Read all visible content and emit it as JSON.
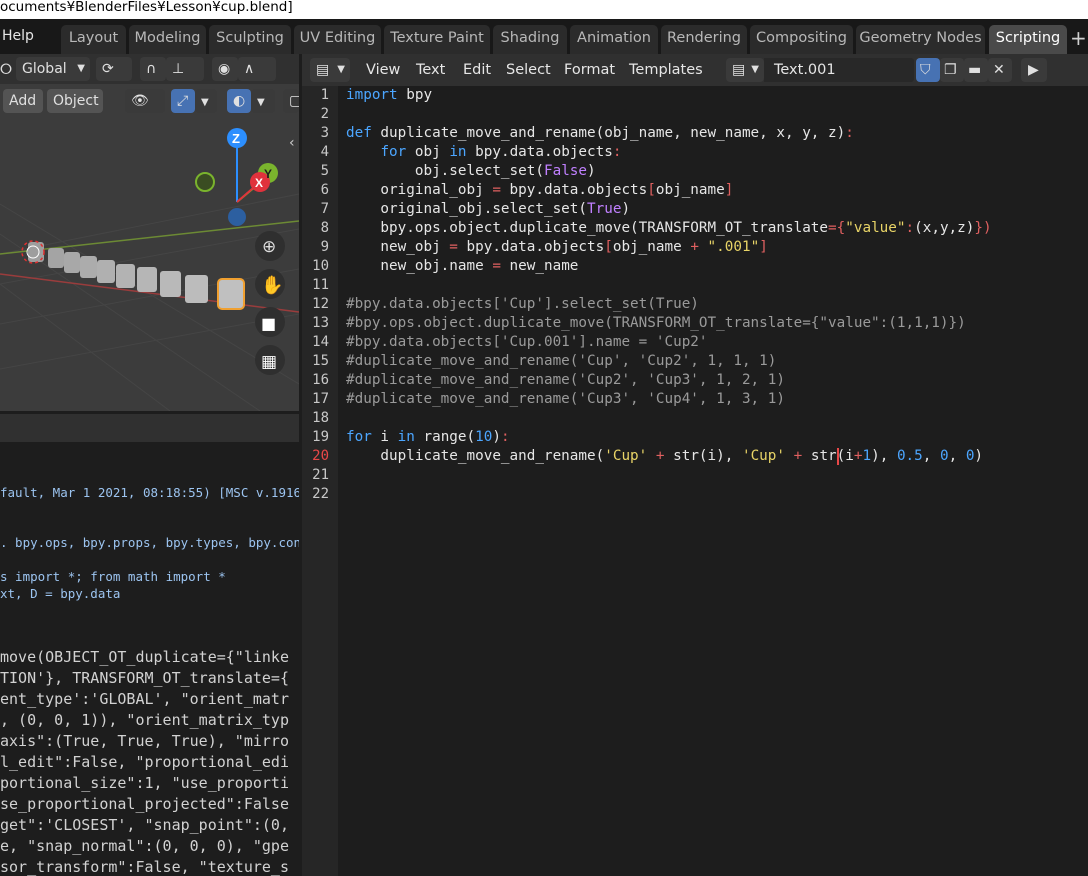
{
  "window": {
    "title": "ocuments¥BlenderFiles¥Lesson¥cup.blend]"
  },
  "topbar": {
    "help_label": "Help",
    "tabs": [
      {
        "label": "Layout"
      },
      {
        "label": "Modeling"
      },
      {
        "label": "Sculpting"
      },
      {
        "label": "UV Editing"
      },
      {
        "label": "Texture Paint"
      },
      {
        "label": "Shading"
      },
      {
        "label": "Animation"
      },
      {
        "label": "Rendering"
      },
      {
        "label": "Compositing"
      },
      {
        "label": "Geometry Nodes"
      },
      {
        "label": "Scripting",
        "active": true
      }
    ],
    "add_tab_symbol": "+"
  },
  "viewport": {
    "orientation_label": "Global",
    "add_label": "Add",
    "object_label": "Object",
    "gizmo_z": "Z",
    "gizmo_y": "Y",
    "gizmo_x": "X"
  },
  "console": {
    "lines": [
      "fault, Mar  1 2021, 08:18:55) [MSC v.1916",
      ". bpy.ops, bpy.props, bpy.types, bpy.cont",
      "s import *; from math import *",
      "xt, D = bpy.data"
    ]
  },
  "info": {
    "lines": [
      "move(OBJECT_OT_duplicate={\"linke",
      "TION'}, TRANSFORM_OT_translate={",
      "ent_type':'GLOBAL', \"orient_matr",
      ", (0, 0, 1)), \"orient_matrix_typ",
      "axis\":(True, True, True), \"mirro",
      "l_edit\":False, \"proportional_edi",
      "portional_size\":1, \"use_proporti",
      "se_proportional_projected\":False",
      "get\":'CLOSEST', \"snap_point\":(0,",
      "e, \"snap_normal\":(0, 0, 0), \"gpe",
      "sor_transform\":False, \"texture_s"
    ]
  },
  "editor": {
    "menus": [
      "View",
      "Text",
      "Edit",
      "Select",
      "Format",
      "Templates"
    ],
    "text_name": "Text.001",
    "current_line": 20,
    "line_count": 22,
    "code": [
      [
        [
          "kw",
          "import"
        ],
        [
          "pl",
          " bpy"
        ]
      ],
      [],
      [
        [
          "kw",
          "def"
        ],
        [
          "pl",
          " duplicate_move_and_rename(obj_name, new_name, x, y, z)"
        ],
        [
          "op",
          ":"
        ]
      ],
      [
        [
          "pl",
          "    "
        ],
        [
          "kw",
          "for"
        ],
        [
          "pl",
          " obj "
        ],
        [
          "kw",
          "in"
        ],
        [
          "pl",
          " bpy.data.objects"
        ],
        [
          "op",
          ":"
        ]
      ],
      [
        [
          "pl",
          "        obj.select_set("
        ],
        [
          "bi",
          "False"
        ],
        [
          "pl",
          ")"
        ]
      ],
      [
        [
          "pl",
          "    original_obj "
        ],
        [
          "op",
          "="
        ],
        [
          "pl",
          " bpy.data.objects"
        ],
        [
          "op",
          "["
        ],
        [
          "pl",
          "obj_name"
        ],
        [
          "op",
          "]"
        ]
      ],
      [
        [
          "pl",
          "    original_obj.select_set("
        ],
        [
          "bi",
          "True"
        ],
        [
          "pl",
          ")"
        ]
      ],
      [
        [
          "pl",
          "    bpy.ops.object.duplicate_move(TRANSFORM_OT_translate"
        ],
        [
          "op",
          "={"
        ],
        [
          "str",
          "\"value\""
        ],
        [
          "op",
          ":"
        ],
        [
          "pl",
          "(x,y,z)"
        ],
        [
          "op",
          "})"
        ]
      ],
      [
        [
          "pl",
          "    new_obj "
        ],
        [
          "op",
          "="
        ],
        [
          "pl",
          " bpy.data.objects"
        ],
        [
          "op",
          "["
        ],
        [
          "pl",
          "obj_name "
        ],
        [
          "op",
          "+"
        ],
        [
          "pl",
          " "
        ],
        [
          "str",
          "\".001\""
        ],
        [
          "op",
          "]"
        ]
      ],
      [
        [
          "pl",
          "    new_obj.name "
        ],
        [
          "op",
          "="
        ],
        [
          "pl",
          " new_name"
        ]
      ],
      [],
      [
        [
          "cm",
          "#bpy.data.objects['Cup'].select_set(True)"
        ]
      ],
      [
        [
          "cm",
          "#bpy.ops.object.duplicate_move(TRANSFORM_OT_translate={\"value\":(1,1,1)})"
        ]
      ],
      [
        [
          "cm",
          "#bpy.data.objects['Cup.001'].name = 'Cup2'"
        ]
      ],
      [
        [
          "cm",
          "#duplicate_move_and_rename('Cup', 'Cup2', 1, 1, 1)"
        ]
      ],
      [
        [
          "cm",
          "#duplicate_move_and_rename('Cup2', 'Cup3', 1, 2, 1)"
        ]
      ],
      [
        [
          "cm",
          "#duplicate_move_and_rename('Cup3', 'Cup4', 1, 3, 1)"
        ]
      ],
      [],
      [
        [
          "kw",
          "for"
        ],
        [
          "pl",
          " i "
        ],
        [
          "kw",
          "in"
        ],
        [
          "pl",
          " range("
        ],
        [
          "num",
          "10"
        ],
        [
          "pl",
          ")"
        ],
        [
          "op",
          ":"
        ]
      ],
      [
        [
          "pl",
          "    duplicate_move_and_rename("
        ],
        [
          "str",
          "'Cup'"
        ],
        [
          "pl",
          " "
        ],
        [
          "op",
          "+"
        ],
        [
          "pl",
          " str(i), "
        ],
        [
          "str",
          "'Cup'"
        ],
        [
          "pl",
          " "
        ],
        [
          "op",
          "+"
        ],
        [
          "pl",
          " str(i"
        ],
        [
          "op",
          "+"
        ],
        [
          "num",
          "1"
        ],
        [
          "pl",
          "), "
        ],
        [
          "num",
          "0.5"
        ],
        [
          "pl",
          ", "
        ],
        [
          "num",
          "0"
        ],
        [
          "pl",
          ", "
        ],
        [
          "num",
          "0"
        ],
        [
          "pl",
          ")"
        ]
      ],
      [],
      []
    ]
  },
  "colors": {
    "accent_blue": "#4772b3",
    "gizmo_x": "#e0323c",
    "gizmo_y": "#7ab42d",
    "gizmo_z": "#2c8fff",
    "selection_orange": "#f0a030"
  }
}
